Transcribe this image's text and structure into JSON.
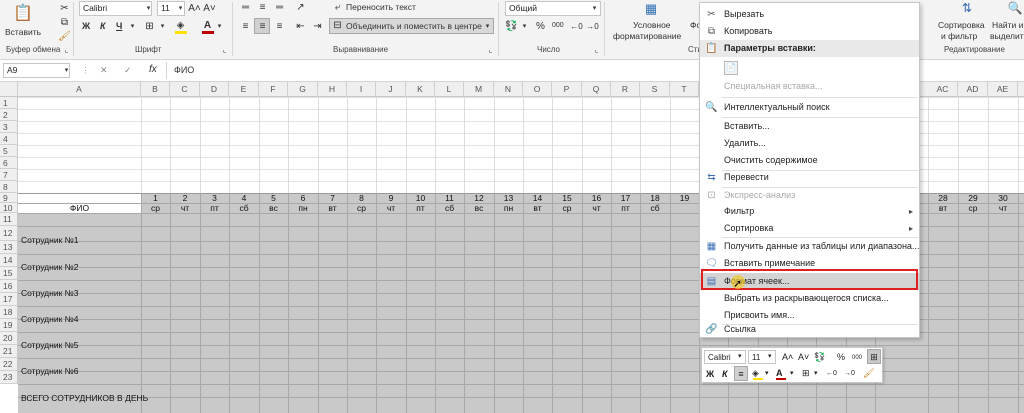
{
  "ribbon": {
    "paste_label": "Вставить",
    "clipboard_label": "Буфер обмена",
    "font_name": "Calibri",
    "font_size": "11",
    "bold": "Ж",
    "italic": "К",
    "underline": "Ч",
    "font_group_label": "Шрифт",
    "wrap_text": "Переносить текст",
    "merge_center": "Объединить и поместить в центре",
    "alignment_label": "Выравнивание",
    "number_format": "Общий",
    "percent": "%",
    "thousands": "000",
    "number_label": "Число",
    "cond_format_line1": "Условное",
    "cond_format_line2": "форматирование",
    "styles_label": "Сти",
    "format_partial": "Фо",
    "sort_filter_line1": "Сортировка",
    "sort_filter_line2": "и фильтр",
    "find_line1": "Найти и",
    "find_line2": "выделить",
    "editing_label": "Редактирование",
    "font_color": "#c00000",
    "fill_color": "#ffe100"
  },
  "formula_bar": {
    "name_box": "A9",
    "cancel": "✕",
    "enter": "✓",
    "fx": "fx",
    "value": "ФИО"
  },
  "columns": [
    "A",
    "B",
    "C",
    "D",
    "E",
    "F",
    "G",
    "H",
    "I",
    "J",
    "K",
    "L",
    "M",
    "N",
    "O",
    "P",
    "Q",
    "R",
    "S",
    "T",
    "",
    "",
    "",
    "",
    "",
    "",
    "",
    "AC",
    "AD",
    "AE"
  ],
  "rows": [
    "1",
    "2",
    "3",
    "4",
    "5",
    "6",
    "7",
    "8",
    "9",
    "10",
    "11",
    "12",
    "13",
    "14",
    "15",
    "16",
    "17",
    "18",
    "19",
    "20",
    "21",
    "22",
    "23"
  ],
  "table": {
    "fio_header": "ФИО",
    "days_left": [
      "1",
      "2",
      "3",
      "4",
      "5",
      "6",
      "7",
      "8",
      "9",
      "10",
      "11",
      "12",
      "13",
      "14",
      "15",
      "16",
      "17",
      "18",
      "19"
    ],
    "weekdays_left": [
      "ср",
      "чт",
      "пт",
      "сб",
      "вс",
      "пн",
      "вт",
      "ср",
      "чт",
      "пт",
      "сб",
      "вс",
      "пн",
      "вт",
      "ср",
      "чт",
      "пт",
      "сб",
      ""
    ],
    "days_right": [
      "28",
      "29",
      "30"
    ],
    "weekdays_right": [
      "вт",
      "ср",
      "чт"
    ],
    "employees": [
      "Сотрудник №1",
      "Сотрудник №2",
      "Сотрудник №3",
      "Сотрудник №4",
      "Сотрудник №5",
      "Сотрудник №6"
    ],
    "total_label": "ВСЕГО СОТРУДНИКОВ В ДЕНЬ"
  },
  "context_menu": {
    "cut": "Вырезать",
    "copy": "Копировать",
    "paste_options": "Параметры вставки:",
    "paste_special": "Специальная вставка...",
    "smart_lookup": "Интеллектуальный поиск",
    "insert": "Вставить...",
    "delete": "Удалить...",
    "clear_contents": "Очистить содержимое",
    "translate": "Перевести",
    "quick_analysis": "Экспресс-анализ",
    "filter": "Фильтр",
    "sort": "Сортировка",
    "get_data": "Получить данные из таблицы или диапазона...",
    "insert_comment": "Вставить примечание",
    "format_cells": "Формат ячеек...",
    "pick_from_list": "Выбрать из раскрывающегося списка...",
    "define_name": "Присвоить имя...",
    "link": "Ссылка",
    "highlight_color": "#e02020"
  },
  "mini_toolbar": {
    "font_name": "Calibri",
    "font_size": "11",
    "bold": "Ж",
    "italic": "К",
    "percent": "%",
    "thousands": "000"
  }
}
